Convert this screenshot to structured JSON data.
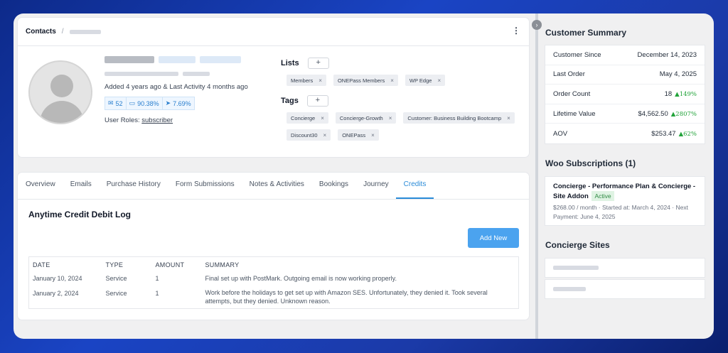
{
  "breadcrumb": {
    "root": "Contacts",
    "separator": "/"
  },
  "contact": {
    "added_text": "Added 4 years ago & Last Activity 4 months ago",
    "stats": [
      {
        "icon": "mail-icon",
        "value": "52"
      },
      {
        "icon": "folder-icon",
        "value": "90.38%"
      },
      {
        "icon": "send-icon",
        "value": "7.69%"
      }
    ],
    "roles_label": "User Roles:",
    "role": "subscriber"
  },
  "lists": {
    "title": "Lists",
    "add": "+",
    "items": [
      "Members",
      "ONEPass Members",
      "WP Edge"
    ]
  },
  "tags": {
    "title": "Tags",
    "add": "+",
    "items": [
      "Concierge",
      "Concierge-Growth",
      "Customer: Business Building Bootcamp",
      "Discount30",
      "ONEPass"
    ]
  },
  "tabs": [
    "Overview",
    "Emails",
    "Purchase History",
    "Form Submissions",
    "Notes & Activities",
    "Bookings",
    "Journey",
    "Credits"
  ],
  "active_tab": "Credits",
  "credits": {
    "title": "Anytime Credit Debit Log",
    "add_button": "Add New",
    "columns": [
      "DATE",
      "TYPE",
      "AMOUNT",
      "SUMMARY"
    ],
    "rows": [
      {
        "date": "January 10, 2024",
        "type": "Service",
        "amount": "1",
        "summary": "Final set up with PostMark. Outgoing email is now working properly."
      },
      {
        "date": "January 2, 2024",
        "type": "Service",
        "amount": "1",
        "summary": "Work before the holidays to get set up with Amazon SES. Unfortunately, they denied it. Took several attempts, but they denied. Unknown reason."
      }
    ]
  },
  "customer_summary": {
    "title": "Customer Summary",
    "rows": [
      {
        "label": "Customer Since",
        "value": "December 14, 2023",
        "trend": ""
      },
      {
        "label": "Last Order",
        "value": "May 4, 2025",
        "trend": ""
      },
      {
        "label": "Order Count",
        "value": "18",
        "trend": "▲149%"
      },
      {
        "label": "Lifetime Value",
        "value": "$4,562.50",
        "trend": "▲2807%"
      },
      {
        "label": "AOV",
        "value": "$253.47",
        "trend": "▲62%"
      }
    ]
  },
  "subscriptions": {
    "title": "Woo Subscriptions (1)",
    "item_title": "Concierge - Performance Plan & Concierge - Site Addon",
    "status": "Active",
    "meta": "$268.00 / month · Started at: March 4, 2024 · Next Payment: June 4, 2025"
  },
  "concierge_sites": {
    "title": "Concierge Sites"
  },
  "colors": {
    "accent": "#2a8bd8",
    "button": "#4ba3ef",
    "trend_up": "#22a33a"
  }
}
